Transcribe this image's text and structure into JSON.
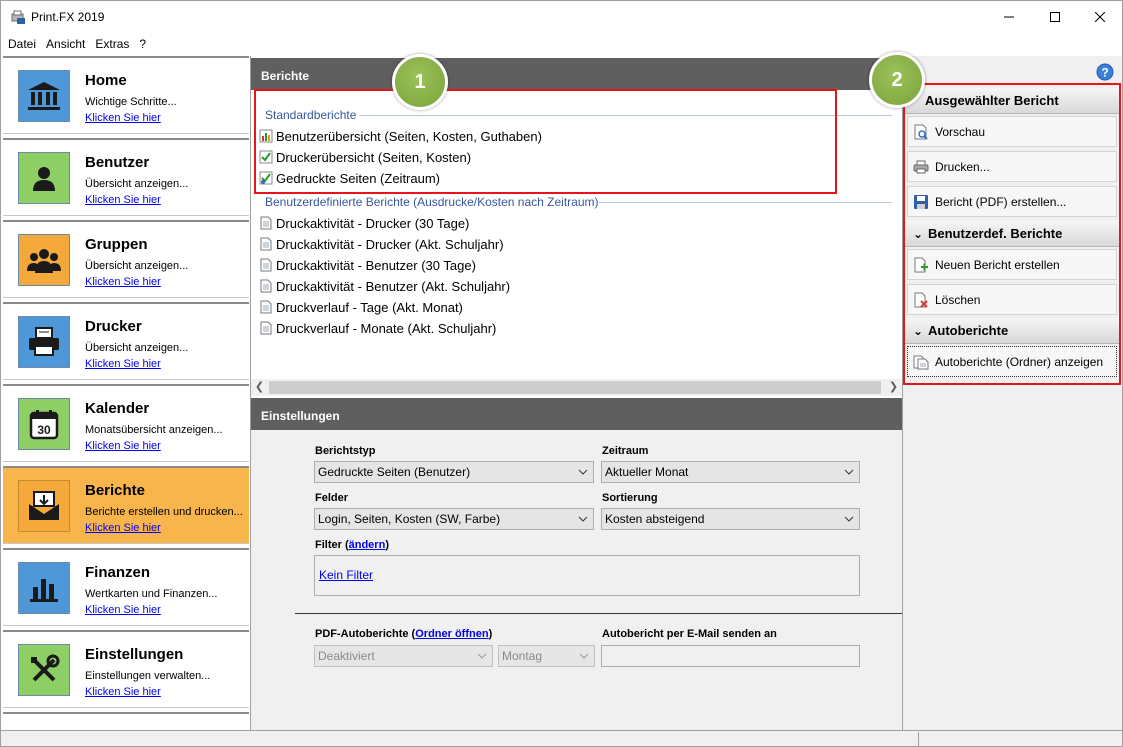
{
  "window": {
    "title": "Print.FX 2019"
  },
  "menu": [
    "Datei",
    "Ansicht",
    "Extras",
    "?"
  ],
  "sidebar": {
    "items": [
      {
        "title": "Home",
        "desc": "Wichtige Schritte...",
        "link": "Klicken Sie hier",
        "icon": "home-icon",
        "color": "#4f98d8"
      },
      {
        "title": "Benutzer",
        "desc": "Übersicht anzeigen...",
        "link": "Klicken Sie hier",
        "icon": "user-icon",
        "color": "#8ecf65"
      },
      {
        "title": "Gruppen",
        "desc": "Übersicht anzeigen...",
        "link": "Klicken Sie hier",
        "icon": "group-icon",
        "color": "#f6a93b"
      },
      {
        "title": "Drucker",
        "desc": "Übersicht anzeigen...",
        "link": "Klicken Sie hier",
        "icon": "printer-icon",
        "color": "#4f98d8"
      },
      {
        "title": "Kalender",
        "desc": "Monatsübersicht anzeigen...",
        "link": "Klicken Sie hier",
        "icon": "calendar-icon",
        "color": "#8ecf65"
      },
      {
        "title": "Berichte",
        "desc": "Berichte erstellen und drucken...",
        "link": "Klicken Sie hier",
        "icon": "reports-icon",
        "color": "#f6a93b",
        "active": true
      },
      {
        "title": "Finanzen",
        "desc": "Wertkarten und Finanzen...",
        "link": "Klicken Sie hier",
        "icon": "finance-icon",
        "color": "#4f98d8"
      },
      {
        "title": "Einstellungen",
        "desc": "Einstellungen verwalten...",
        "link": "Klicken Sie hier",
        "icon": "settings-tools-icon",
        "color": "#8ecf65"
      }
    ]
  },
  "reports": {
    "header": "Berichte",
    "standard_label": "Standardberichte",
    "standard": [
      "Benutzerübersicht (Seiten, Kosten, Guthaben)",
      "Druckerübersicht (Seiten, Kosten)",
      "Gedruckte Seiten (Zeitraum)"
    ],
    "custom_label": "Benutzerdefinierte Berichte (Ausdrucke/Kosten nach Zeitraum)",
    "custom": [
      "Druckaktivität - Drucker (30 Tage)",
      "Druckaktivität - Drucker (Akt. Schuljahr)",
      "Druckaktivität - Benutzer (30 Tage)",
      "Druckaktivität - Benutzer (Akt. Schuljahr)",
      "Druckverlauf - Tage (Akt. Monat)",
      "Druckverlauf - Monate (Akt. Schuljahr)"
    ]
  },
  "settings": {
    "header": "Einstellungen",
    "berichtstyp_label": "Berichtstyp",
    "berichtstyp_value": "Gedruckte Seiten (Benutzer)",
    "zeitraum_label": "Zeitraum",
    "zeitraum_value": "Aktueller Monat",
    "felder_label": "Felder",
    "felder_value": "Login, Seiten, Kosten (SW, Farbe)",
    "sortierung_label": "Sortierung",
    "sortierung_value": "Kosten absteigend",
    "filter_label": "Filter (",
    "filter_link": "ändern",
    "filter_close": ")",
    "filter_value": "Kein Filter",
    "pdf_label": "PDF-Autoberichte (",
    "pdf_link": "Ordner öffnen",
    "pdf_close": ")",
    "pdf_value": "Deaktiviert",
    "day_value": "Montag",
    "email_label": "Autobericht per E-Mail senden an",
    "email_value": ""
  },
  "rightpanel": {
    "section1": "Ausgewählter Bericht",
    "btn_preview": "Vorschau",
    "btn_print": "Drucken...",
    "btn_pdf": "Bericht (PDF) erstellen...",
    "section2": "Benutzerdef. Berichte",
    "btn_new": "Neuen Bericht erstellen",
    "btn_delete": "Löschen",
    "section3": "Autoberichte",
    "btn_auto": "Autoberichte (Ordner) anzeigen"
  },
  "annotations": {
    "badge1": "1",
    "badge2": "2"
  },
  "colors": {
    "accent_active": "#f8b54c",
    "annotation_red": "#e4161c",
    "badge_green": "#8ab44a",
    "header_gray": "#5f5f5f",
    "link_blue": "#0000ee"
  }
}
